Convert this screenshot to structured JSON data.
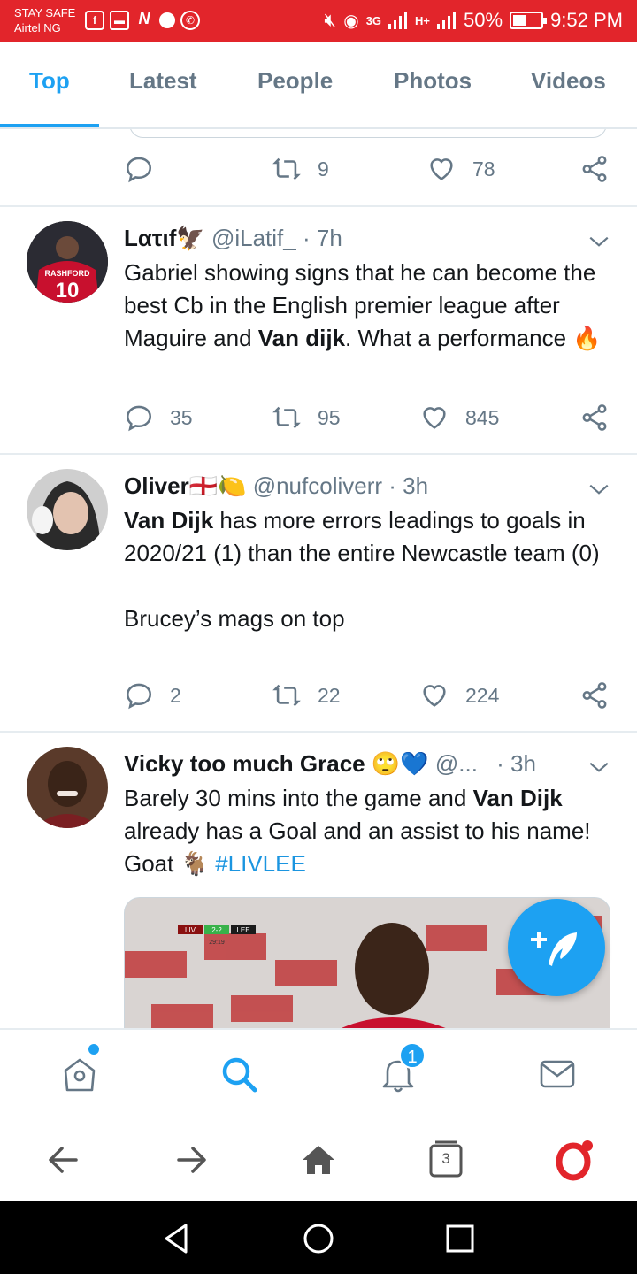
{
  "status_bar": {
    "line1": "STAY SAFE",
    "line2": "Airtel NG",
    "network1": "3G",
    "network2": "H+",
    "battery": "50%",
    "battery_level": 0.5,
    "time": "9:52 PM"
  },
  "tabs": [
    {
      "label": "Top",
      "active": true
    },
    {
      "label": "Latest",
      "active": false
    },
    {
      "label": "People",
      "active": false
    },
    {
      "label": "Photos",
      "active": false
    },
    {
      "label": "Videos",
      "active": false
    }
  ],
  "prev_tweet": {
    "replies": "",
    "retweets": "9",
    "likes": "78"
  },
  "tweets": [
    {
      "name": "Lατιf",
      "name_emoji": "🦅",
      "handle": "@iLatif_",
      "time": "· 7h",
      "text_parts": [
        "Gabriel showing signs that he can become the best Cb in the English premier league after Maguire and ",
        "Van dijk",
        ". What a performance 🔥"
      ],
      "replies": "35",
      "retweets": "95",
      "likes": "845",
      "avatar_text": "RASHFORD 10"
    },
    {
      "name": "Oliver",
      "name_emoji": "🏴󠁧󠁢󠁥󠁮󠁧󠁿🍋",
      "handle": "@nufcoliverr",
      "time": "· 3h",
      "text_bold": "Van Dijk",
      "text_rest": " has more errors leadings to goals in 2020/21 (1) than the entire Newcastle team (0)",
      "text_second": "Brucey’s mags on top",
      "replies": "2",
      "retweets": "22",
      "likes": "224"
    },
    {
      "name": "Vicky too much Grace",
      "name_emoji": "🙄💙",
      "handle": "@...",
      "time": "· 3h",
      "text_a": "Barely 30 mins into the game and ",
      "text_bold": "Van Dijk",
      "text_b": " already has a Goal and an assist to his name! Goat 🐐 ",
      "hashtag": "#LIVLEE",
      "score_home": "LIV",
      "score": "2-2",
      "score_away": "LEE",
      "score_time": "29:19"
    }
  ],
  "bottom_nav": {
    "items": [
      "home-icon",
      "search-icon",
      "notifications-icon",
      "messages-icon"
    ],
    "notification_badge": "1"
  },
  "browser_nav": {
    "tab_count": "3"
  }
}
